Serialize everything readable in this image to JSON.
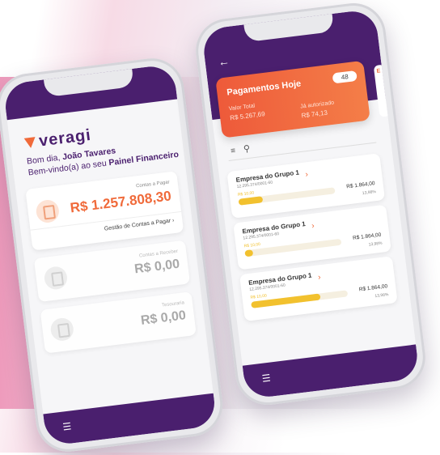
{
  "colors": {
    "brand_purple": "#4a1f6e",
    "accent_orange": "#f06a3a",
    "bar_yellow": "#f2c12e",
    "bg_pink": "#ee9bbc"
  },
  "left_phone": {
    "logo": "veragi",
    "greeting_prefix": "Bom dia, ",
    "user_name": "João Tavares",
    "welcome_prefix": "Bem-vindo(a) ao seu ",
    "welcome_bold": "Painel Financeiro",
    "payables": {
      "label": "Contas a Pagar",
      "value": "R$ 1.257.808,30",
      "link": "Gestão de Contas a Pagar ›"
    },
    "receivables": {
      "label": "Contas a Receber",
      "value": "R$ 0,00"
    },
    "treasury": {
      "label": "Tesouraria",
      "value": "R$ 0,00"
    },
    "menu_icon": "hamburger-icon"
  },
  "right_phone": {
    "back_icon": "back-arrow-icon",
    "title": "Pagamentos Hoje",
    "count": "48",
    "total_label": "Valor Total",
    "total_value": "R$ 5.267,69",
    "authorized_label": "Já autorizado",
    "authorized_value": "R$ 74,13",
    "peek_letter": "E",
    "filter_icon": "filter-icon",
    "search_icon": "search-icon",
    "items": [
      {
        "name": "Empresa do Grupo 1",
        "cnpj": "12.295.374/0001-60",
        "small_value": "R$ 10,00",
        "amount": "R$ 1.864,00",
        "percent": "13,98%",
        "progress": 0.25
      },
      {
        "name": "Empresa do Grupo 1",
        "cnpj": "12.295.374/0001-60",
        "small_value": "R$ 10,00",
        "amount": "R$ 1.864,00",
        "percent": "13,98%",
        "progress": 0.08
      },
      {
        "name": "Empresa do Grupo 1",
        "cnpj": "12.295.374/0001-60",
        "small_value": "R$ 10,00",
        "amount": "R$ 1.864,00",
        "percent": "13,98%",
        "progress": 0.72
      }
    ],
    "menu_icon": "hamburger-icon"
  }
}
